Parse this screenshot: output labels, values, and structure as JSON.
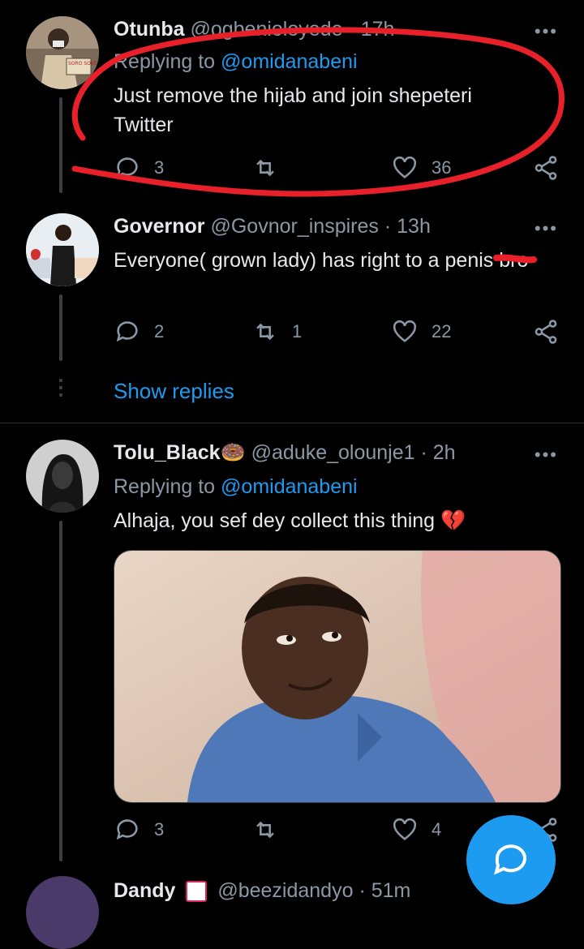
{
  "tweets": [
    {
      "name": "Otunba",
      "handle": "@ogbenioloyede",
      "time": "· 17h",
      "replying_label": "Replying to",
      "replying_handle": "@omidanabeni",
      "text": "Just remove the hijab and join shepeteri Twitter",
      "replies": "3",
      "retweets": "",
      "likes": "36",
      "avatar_sign": "SORO SOKE"
    },
    {
      "name": "Governor",
      "handle": "@Govnor_inspires",
      "time": "· 13h",
      "text": "Everyone( grown lady) has right to a penis bro",
      "replies": "2",
      "retweets": "1",
      "likes": "22"
    },
    {
      "name": "Tolu_Black🍩",
      "handle": "@aduke_olounje1",
      "time": "· 2h",
      "replying_label": "Replying to",
      "replying_handle": "@omidanabeni",
      "text": "Alhaja, you sef dey collect this thing 💔",
      "replies": "3",
      "retweets": "",
      "likes": "4"
    },
    {
      "name": "Dandy",
      "handle": "@beezidandyo",
      "time": "· 51m"
    }
  ],
  "show_replies_label": "Show replies",
  "more_label": "•••",
  "colors": {
    "background": "#000000",
    "accent": "#1d9bf0",
    "muted": "#8b98a5",
    "annotation": "#e8202a"
  },
  "icons": [
    "reply-icon",
    "retweet-icon",
    "like-icon",
    "share-icon",
    "compose-reply-icon",
    "emoji-badge-icon"
  ]
}
